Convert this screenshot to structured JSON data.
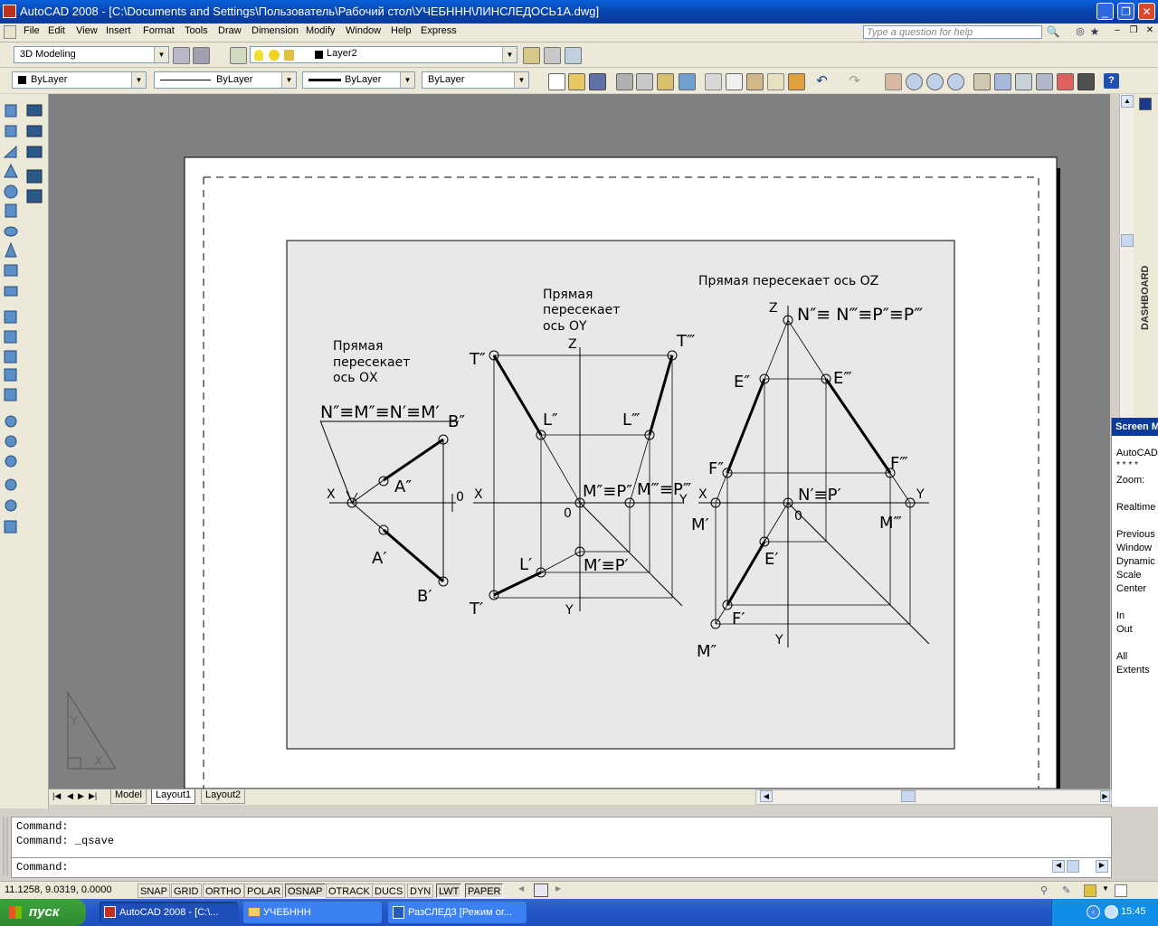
{
  "window": {
    "title": "AutoCAD 2008 - [C:\\Documents and Settings\\Пользователь\\Рабочий стол\\УЧЕБННН\\ЛИНСЛЕДОСЬ1А.dwg]"
  },
  "menu": {
    "items": [
      "File",
      "Edit",
      "View",
      "Insert",
      "Format",
      "Tools",
      "Draw",
      "Dimension",
      "Modify",
      "Window",
      "Help",
      "Express"
    ]
  },
  "help_search": {
    "placeholder": "Type a question for help"
  },
  "toolbar": {
    "workspace": "3D Modeling",
    "layer": "Layer2",
    "color": "ByLayer",
    "linetype": "ByLayer",
    "lineweight": "ByLayer",
    "plotstyle": "ByLayer"
  },
  "drawing": {
    "note_ox": [
      "Прямая",
      "пересекает",
      "ось ОХ"
    ],
    "note_oy": [
      "Прямая",
      "пересекает",
      "ось ОY"
    ],
    "note_oz": "Прямая пересекает ось OZ",
    "labels_ox": {
      "header": "N″≡M″≡N′≡M′",
      "b2": "B″",
      "a2": "A″",
      "a1": "A′",
      "b1": "B′",
      "x": "X",
      "zero": "0"
    },
    "labels_oy": {
      "t2": "T″",
      "t3": "T‴",
      "l2": "L″",
      "l3": "L‴",
      "mp2": "M″≡P″",
      "mp3": "M‴≡P‴",
      "l1": "L′",
      "mp1": "M′≡P′",
      "t1": "T′",
      "x": "X",
      "y": "Y",
      "z": "Z",
      "y2": "Y",
      "zero": "0"
    },
    "labels_oz": {
      "header": "N″≡ N‴≡P″≡P‴",
      "z": "Z",
      "e2": "E″",
      "e3": "E‴",
      "f2": "F″",
      "f3": "F‴",
      "x": "X",
      "y": "Y",
      "m1": "M′",
      "np1": "N′≡P′",
      "zero": "0",
      "m3": "M‴",
      "e1": "E′",
      "f1": "F′",
      "m2": "M″",
      "y2": "Y"
    },
    "ucs": {
      "y": "Y",
      "x": "X"
    }
  },
  "layout_tabs": [
    "Model",
    "Layout1",
    "Layout2"
  ],
  "screen_menu": {
    "header": "Screen Menu",
    "items": [
      "AutoCAD",
      "* * * *",
      "Zoom:",
      "Realtime",
      "Previous",
      "Window",
      "Dynamic",
      "Scale",
      "Center",
      "In",
      "Out",
      "All",
      "Extents"
    ]
  },
  "dashboard": {
    "label": "DASHBOARD"
  },
  "command_lines": [
    "Command:",
    "Command: _qsave",
    "Command:"
  ],
  "status": {
    "coords": "11.1258, 9.0319, 0.0000",
    "toggles": [
      "SNAP",
      "GRID",
      "ORTHO",
      "POLAR",
      "OSNAP",
      "OTRACK",
      "DUCS",
      "DYN",
      "LWT",
      "PAPER"
    ],
    "active": [
      "OSNAP",
      "LWT",
      "PAPER"
    ]
  },
  "taskbar": {
    "start": "пуск",
    "tasks": [
      "AutoCAD 2008 - [C:\\...",
      "УЧЕБННН",
      "РазСЛЕД3 [Режим ог..."
    ],
    "lang": "EN",
    "time": "15:45"
  }
}
